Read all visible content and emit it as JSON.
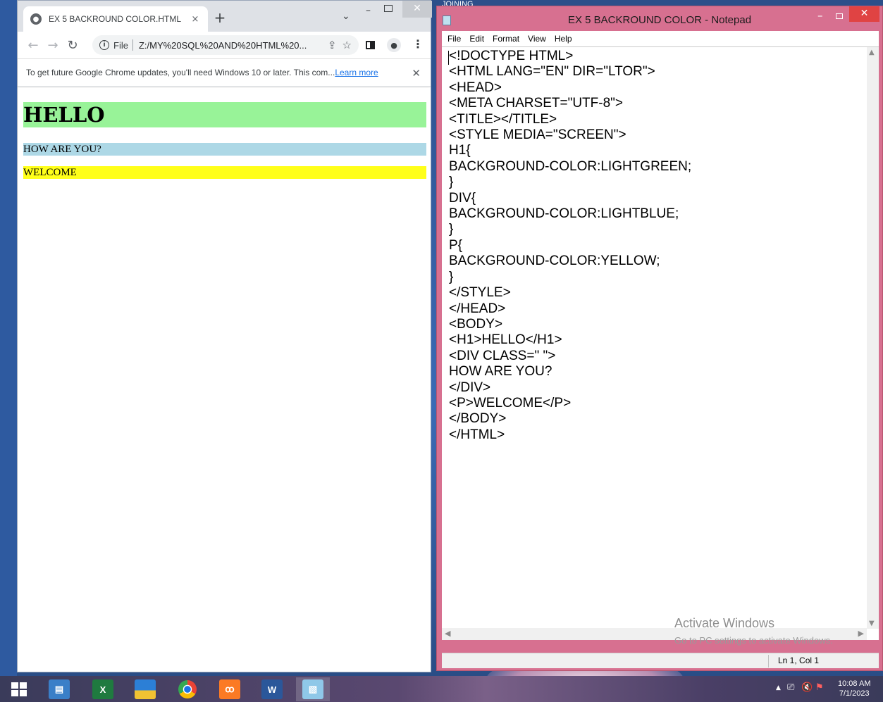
{
  "background_window": {
    "title_fragment": "JOINING"
  },
  "chrome": {
    "tab_title": "EX 5 BACKROUND COLOR.HTML",
    "tab_close": "×",
    "new_tab": "+",
    "tab_list": "⌄",
    "url_scheme": "File",
    "url": "Z:/MY%20SQL%20AND%20HTML%20...",
    "infobar_text": "To get future Google Chrome updates, you'll need Windows 10 or later. This com...",
    "infobar_link": "Learn more",
    "page": {
      "h1": "HELLO",
      "div": "HOW ARE YOU?",
      "p": "WELCOME",
      "colors": {
        "h1_bg": "#98f398",
        "div_bg": "#add8e6",
        "p_bg": "#ffff1a"
      }
    }
  },
  "notepad": {
    "title": "EX 5 BACKROUND COLOR - Notepad",
    "menu": [
      "File",
      "Edit",
      "Format",
      "View",
      "Help"
    ],
    "lines": [
      "<!DOCTYPE HTML>",
      "<HTML LANG=\"EN\" DIR=\"LTOR\">",
      "<HEAD>",
      "<META CHARSET=\"UTF-8\">",
      "<TITLE></TITLE>",
      "<STYLE MEDIA=\"SCREEN\">",
      "H1{",
      "BACKGROUND-COLOR:LIGHTGREEN;",
      "}",
      "DIV{",
      "BACKGROUND-COLOR:LIGHTBLUE;",
      "}",
      "P{",
      "BACKGROUND-COLOR:YELLOW;",
      "}",
      "</STYLE>",
      "</HEAD>",
      "<BODY>",
      "<H1>HELLO</H1>",
      "<DIV CLASS=\" \">",
      "HOW ARE YOU?",
      "</DIV>",
      "<P>WELCOME</P>",
      "</BODY>",
      "</HTML>"
    ],
    "status": "Ln 1, Col 1",
    "watermark_title": "Activate Windows",
    "watermark_sub": "Go to PC settings to activate Windows.",
    "accent_color": "#d77090"
  },
  "taskbar": {
    "apps": [
      {
        "name": "file-explorer",
        "active": false
      },
      {
        "name": "excel",
        "active": false
      },
      {
        "name": "app-blue-yellow",
        "active": false
      },
      {
        "name": "chrome",
        "active": false
      },
      {
        "name": "xampp",
        "active": false
      },
      {
        "name": "word",
        "active": false
      },
      {
        "name": "notepad",
        "active": true
      }
    ],
    "time": "10:08 AM",
    "date": "7/1/2023"
  }
}
